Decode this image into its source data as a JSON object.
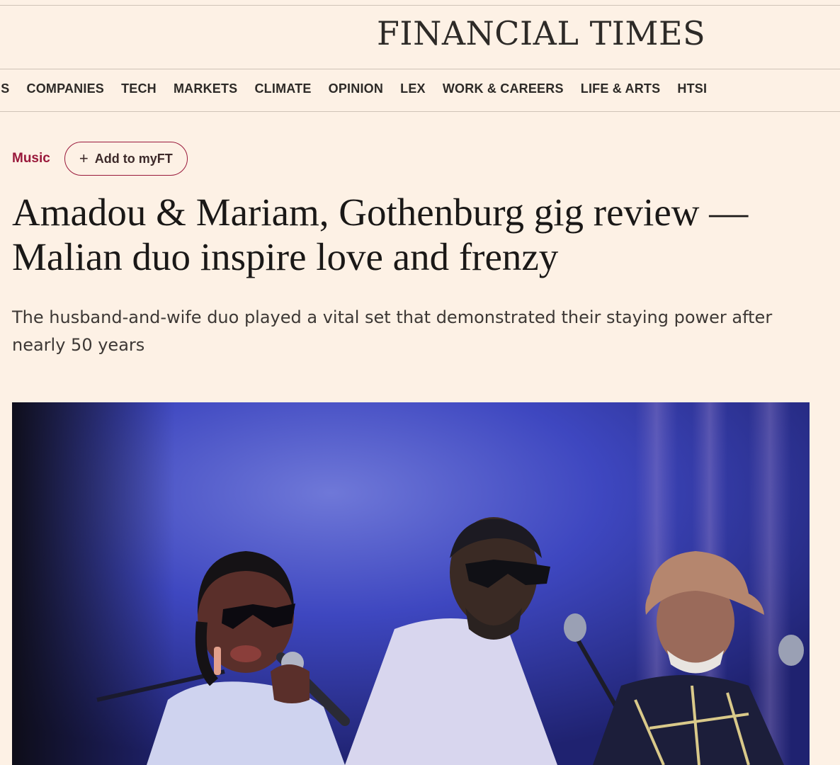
{
  "masthead": {
    "title": "FINANCIAL TIMES"
  },
  "nav": {
    "items": [
      "US",
      "COMPANIES",
      "TECH",
      "MARKETS",
      "CLIMATE",
      "OPINION",
      "LEX",
      "WORK & CAREERS",
      "LIFE & ARTS",
      "HTSI"
    ]
  },
  "article": {
    "topic": "Music",
    "myft_label": "Add to myFT",
    "myft_icon": "plus-icon",
    "headline_line1": "Amadou & Mariam, Gothenburg gig review —",
    "headline_line2": "Malian duo inspire love and frenzy",
    "standfirst": "The husband-and-wife duo played a vital set that demonstrated their staying power after nearly 50 years",
    "image_subject": "photo of performers on stage with microphones under blue light"
  },
  "colors": {
    "page_background": "#fdf1e5",
    "accent": "#99193b",
    "text": "#1a1817"
  }
}
